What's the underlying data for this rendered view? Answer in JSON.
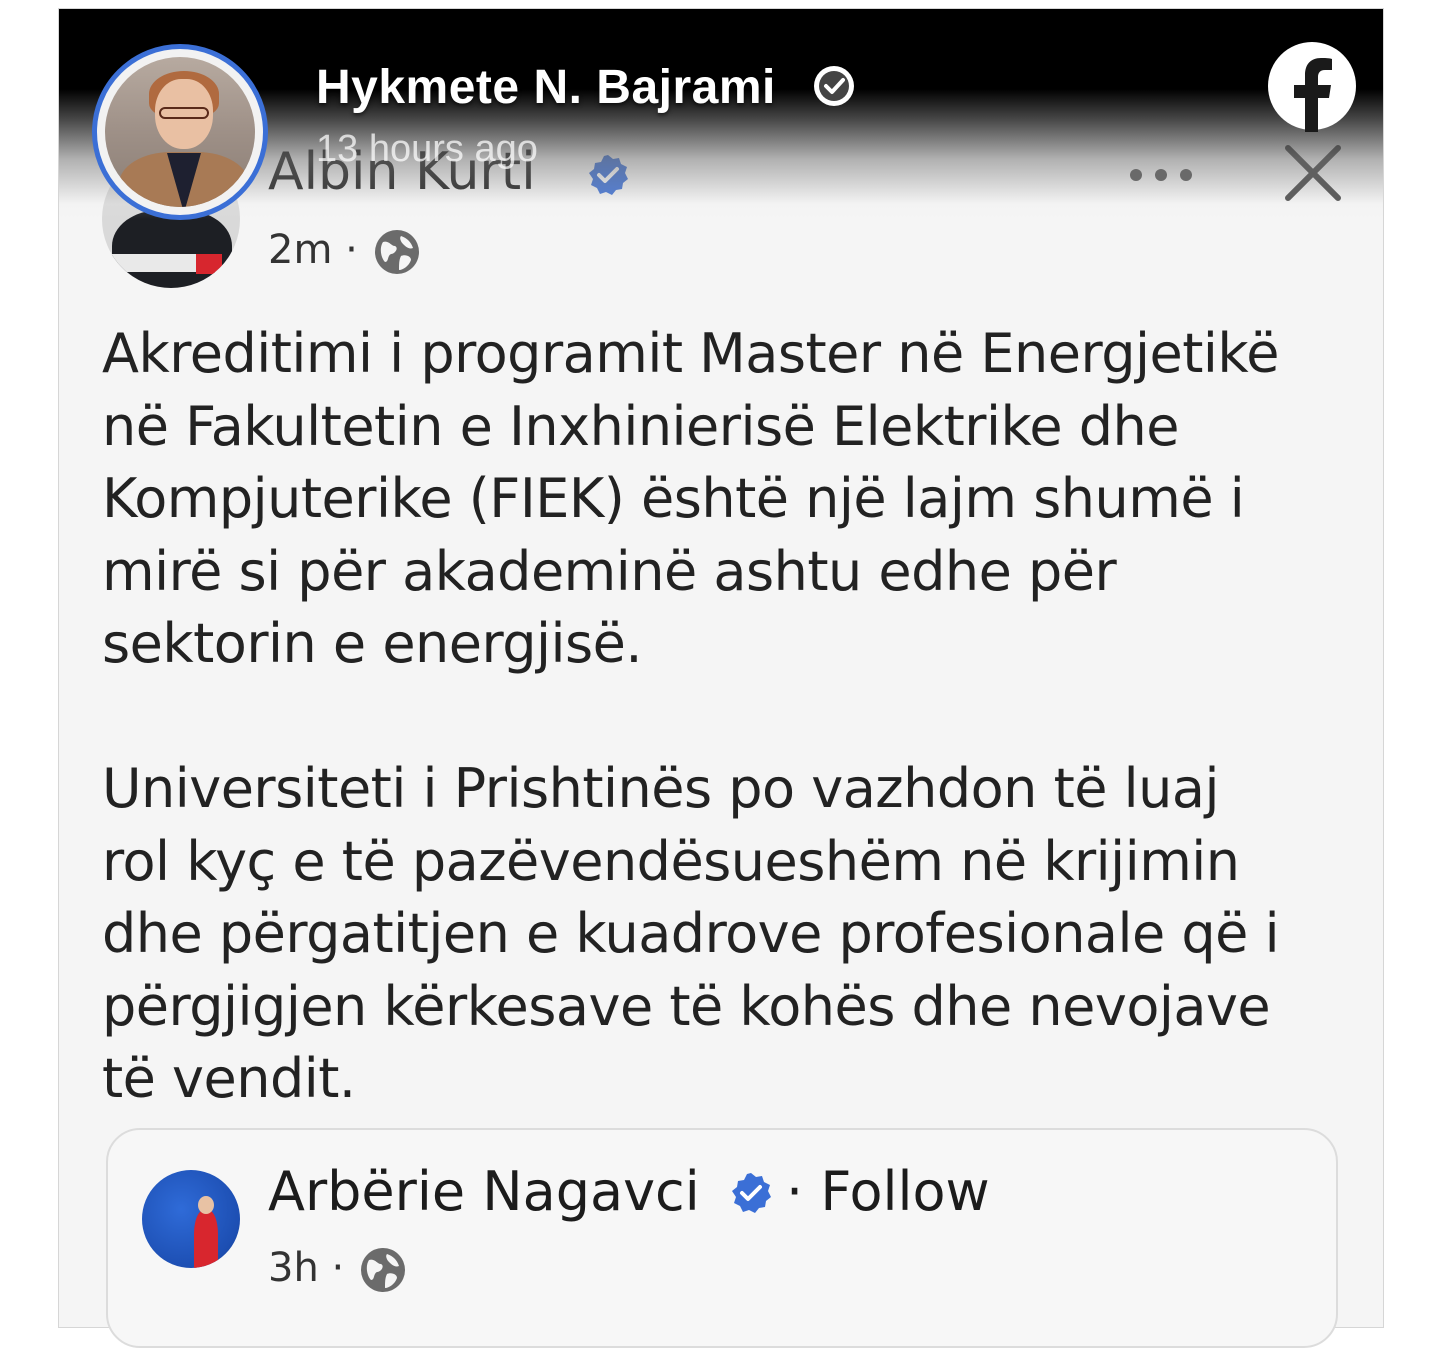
{
  "story_header": {
    "author_name": "Hykmete N. Bajrami",
    "time_ago": "13 hours ago",
    "verified": true,
    "app_icon": "facebook-icon"
  },
  "post": {
    "author_name": "Albin Kurti",
    "verified": true,
    "time": "2m",
    "separator": "·",
    "audience_icon": "globe-icon",
    "paragraphs": [
      [
        "Akreditimi i programit Master në Energjetikë",
        "në Fakultetin e Inxhinierisë Elektrike dhe",
        "Kompjuterike (FIEK) është një lajm shumë i",
        "mirë si për akademinë ashtu edhe për",
        "sektorin e energjisë."
      ],
      [
        "Universiteti i Prishtinës po vazhdon të luaj",
        "rol kyç e të pazëvendësueshëm në krijimin",
        "dhe përgatitjen e kuadrove profesionale që i",
        "përgjigjen kërkesave të kohës dhe nevojave",
        "të vendit."
      ]
    ]
  },
  "shared_post": {
    "author_name": "Arbërie Nagavci",
    "verified": true,
    "follow_label": "· Follow",
    "time": "3h",
    "separator": "·",
    "audience_icon": "globe-icon"
  },
  "colors": {
    "verified_blue": "#3b6fd6",
    "story_ring": "#3b6fd6",
    "text": "#222222"
  }
}
